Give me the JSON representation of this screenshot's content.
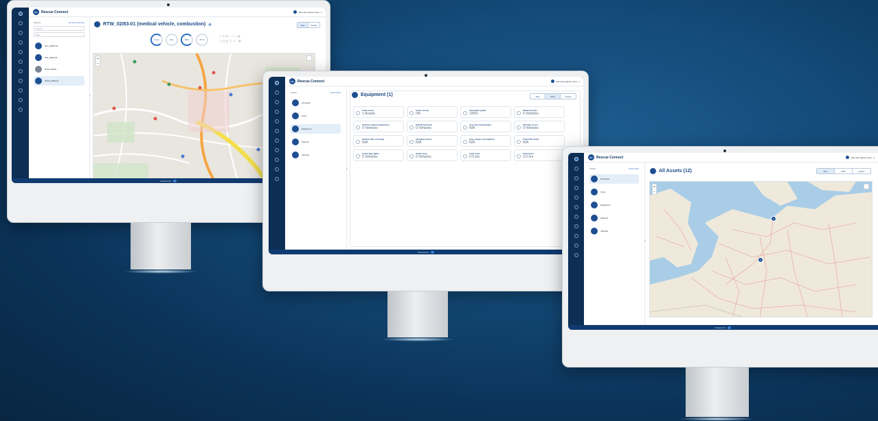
{
  "app_name": "Rescue Connect",
  "logo_mark": "RC",
  "user_label": "John Doe (admin user)",
  "user_caret": "∨",
  "powered_by": "Powered by",
  "collapse_caret": "‹",
  "rail_icons": [
    "home-icon",
    "truck-icon",
    "users-icon",
    "gear-icon",
    "search-icon",
    "wifi-icon",
    "clock-icon",
    "chart-icon",
    "tag-icon",
    "help-icon",
    "info-icon"
  ],
  "screen1": {
    "panel_header": "Objects",
    "panel_link": "All Cells (# items)",
    "search_placeholder": "Search",
    "filter_placeholder": "Filter",
    "objects": [
      "HLF_02/80-01",
      "GW_02/60-01",
      "RTW_Mobile",
      "RTW_02/83-01"
    ],
    "selected_index": 3,
    "grey_index": 2,
    "title": "RTW_02/83-01 (medical vehicle, combustion)",
    "tabs": [
      "Map",
      "Details"
    ],
    "active_tab": 0,
    "gauges": [
      "72 km",
      "46 L",
      "85%",
      "87 %"
    ],
    "status_icons_row1": "▭ ◍ ▤ ◌ ▭ ◇ ▣",
    "status_icons_row2": "▢ ▤ ▥ ◫ ▭ ◌ ▣",
    "zoom_in": "+",
    "zoom_out": "−"
  },
  "screen2": {
    "panel_header": "Assets",
    "panel_link": "Asset Fleet",
    "nav": [
      "All Assets",
      "Crew",
      "Equipment",
      "Patients",
      "Vehicles"
    ],
    "selected_index": 2,
    "title": "Equipment (1)",
    "tabs": [
      "Map",
      "KPIS",
      "Assets"
    ],
    "active_tab": 1,
    "cards": [
      {
        "label": "Total assets",
        "value": "1 Assets"
      },
      {
        "label": "Active assets",
        "value": "0%"
      },
      {
        "label": "Innovation grade",
        "value": "100%"
      },
      {
        "label": "Utilized assets",
        "value": "0 Vehicles"
      },
      {
        "label": "Critical coolant temperature",
        "value": "0 Vehicles"
      },
      {
        "label": "Critical fuel level",
        "value": "0 Vehicles"
      },
      {
        "label": "Avg. fuel consumption",
        "value": "N/A"
      },
      {
        "label": "Tell-tales errors",
        "value": "0 Vehicles"
      },
      {
        "label": "Critical state of charge",
        "value": "N/A"
      },
      {
        "label": "Charging assets",
        "value": "N/A"
      },
      {
        "label": "Avg. energy consumption",
        "value": "N/A"
      },
      {
        "label": "Total CO2 saved",
        "value": "N/A"
      },
      {
        "label": "Active fleet lights",
        "value": "0 Vehicles"
      },
      {
        "label": "Active siren",
        "value": "0 Vehicles"
      },
      {
        "label": "Total route",
        "value": "0.0 km"
      },
      {
        "label": "Total hours",
        "value": "0.0 hrs"
      }
    ]
  },
  "screen3": {
    "panel_header": "Assets",
    "panel_link": "Asset Fleet",
    "nav": [
      "All Assets",
      "Crew",
      "Equipment",
      "Patients",
      "Vehicles"
    ],
    "selected_index": 0,
    "title": "All Assets (12)",
    "tabs": [
      "Map",
      "KPIS",
      "Assets"
    ],
    "active_tab": 0,
    "map_pins": [
      "1",
      "3"
    ]
  },
  "colors": {
    "brand_navy": "#0d2f55",
    "accent_blue": "#1e4f92",
    "footer_blue": "#0f3b70",
    "map_sea": "#a9cde6",
    "map_land": "#efe9dc"
  }
}
